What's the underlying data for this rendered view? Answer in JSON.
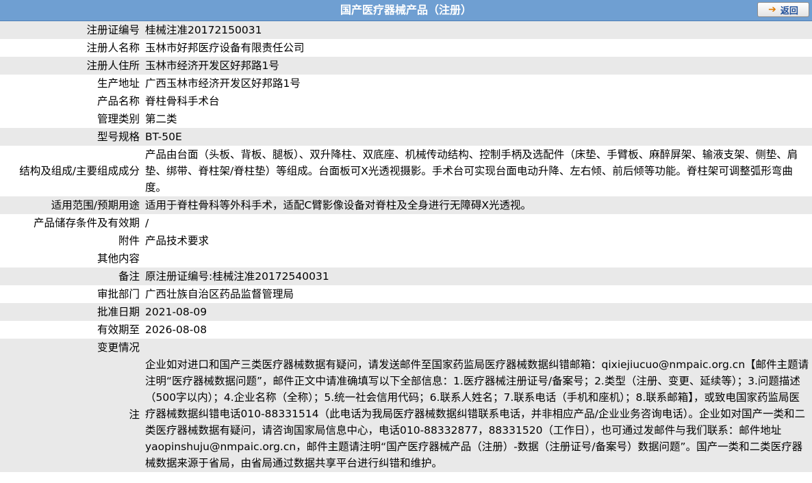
{
  "header": {
    "title": "国产医疗器械产品（注册）",
    "back_label": "返回"
  },
  "rows": [
    {
      "label": "注册证编号",
      "value": "桂械注准20172150031"
    },
    {
      "label": "注册人名称",
      "value": "玉林市好邦医疗设备有限责任公司"
    },
    {
      "label": "注册人住所",
      "value": "玉林市经济开发区好邦路1号"
    },
    {
      "label": "生产地址",
      "value": "广西玉林市经济开发区好邦路1号"
    },
    {
      "label": "产品名称",
      "value": "脊柱骨科手术台"
    },
    {
      "label": "管理类别",
      "value": "第二类"
    },
    {
      "label": "型号规格",
      "value": "BT-50E"
    },
    {
      "label": "结构及组成/主要组成成分",
      "value": "产品由台面（头板、背板、腿板）、双升降柱、双底座、机械传动结构、控制手柄及选配件（床垫、手臂板、麻醉屏架、输液支架、侧垫、肩垫、绑带、脊柱架/脊柱垫）等组成。台面板可X光透视摄影。手术台可实现台面电动升降、左右倾、前后倾等功能。脊柱架可调整弧形弯曲度。"
    },
    {
      "label": "适用范围/预期用途",
      "value": "适用于脊柱骨科等外科手术，适配C臂影像设备对脊柱及全身进行无障碍X光透视。"
    },
    {
      "label": "产品储存条件及有效期",
      "value": "/"
    },
    {
      "label": "附件",
      "value": "产品技术要求"
    },
    {
      "label": "其他内容",
      "value": ""
    },
    {
      "label": "备注",
      "value": "原注册证编号:桂械注准20172540031"
    },
    {
      "label": "审批部门",
      "value": "广西壮族自治区药品监督管理局"
    },
    {
      "label": "批准日期",
      "value": "2021-08-09"
    },
    {
      "label": "有效期至",
      "value": "2026-08-08"
    },
    {
      "label": "变更情况",
      "value": ""
    },
    {
      "label": "注",
      "value": "企业如对进口和国产三类医疗器械数据有疑问，请发送邮件至国家药监局医疗器械数据纠错邮箱：qixiejiucuo@nmpaic.org.cn【邮件主题请注明“医疗器械数据问题”，邮件正文中请准确填写以下全部信息：1.医疗器械注册证号/备案号；2.类型（注册、变更、延续等）；3.问题描述（500字以内）；4.企业名称（全称）；5.统一社会信用代码；6.联系人姓名；7.联系电话（手机和座机）；8.联系邮箱】，或致电国家药监局医疗器械数据纠错电话010-88331514（此电话为我局医疗器械数据纠错联系电话，并非相应产品/企业业务咨询电话）。企业如对国产一类和二类医疗器械数据有疑问，请咨询国家局信息中心，电话010-88332877，88331520（工作日），也可通过发邮件与我们联系：邮件地址yaopinshuju@nmpaic.org.cn，邮件主题请注明“国产医疗器械产品（注册）-数据（注册证号/备案号）数据问题”。国产一类和二类医疗器械数据来源于省局，由省局通过数据共享平台进行纠错和维护。"
    }
  ]
}
